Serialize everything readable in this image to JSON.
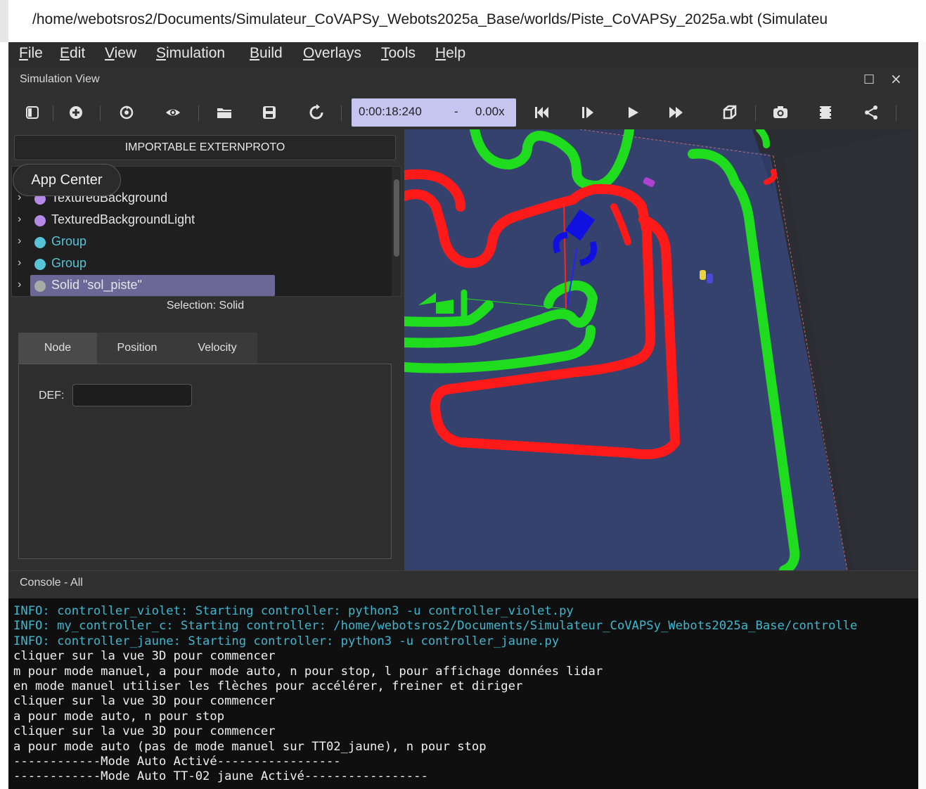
{
  "window": {
    "title": "/home/webotsros2/Documents/Simulateur_CoVAPSy_Webots2025a_Base/worlds/Piste_CoVAPSy_2025a.wbt (Simulateu"
  },
  "menu": [
    "File",
    "Edit",
    "View",
    "Simulation",
    "Build",
    "Overlays",
    "Tools",
    "Help"
  ],
  "simulation_view": {
    "title": "Simulation View",
    "maximize_icon": "□",
    "close_icon": "×"
  },
  "toolbar": {
    "time": "0:00:18:240",
    "dash": "-",
    "speed": "0.00x",
    "icons": [
      "toggle-scene-tree-icon",
      "add-node-icon",
      "reset-view-icon",
      "view-eye-icon",
      "open-world-icon",
      "save-world-icon",
      "reload-world-icon",
      "reset-simulation-icon",
      "step-icon",
      "play-icon",
      "fast-forward-icon",
      "view-cube-icon",
      "screenshot-icon",
      "record-movie-icon",
      "share-icon"
    ]
  },
  "scene_tree": {
    "importable_button": "IMPORTABLE EXTERNPROTO",
    "app_center": "App Center",
    "items": [
      {
        "label": "TexturedBackground",
        "color": "#b48ae6"
      },
      {
        "label": "TexturedBackgroundLight",
        "color": "#b48ae6"
      },
      {
        "label": "Group",
        "color": "#56c4d6"
      },
      {
        "label": "Group",
        "color": "#56c4d6"
      },
      {
        "label": "Solid \"sol_piste\"",
        "color": "#a9aba5"
      }
    ]
  },
  "selection": {
    "label": "Selection: Solid",
    "tabs": [
      "Node",
      "Position",
      "Velocity"
    ],
    "def_label": "DEF:",
    "def_value": ""
  },
  "console": {
    "title": "Console - All",
    "lines": [
      {
        "text": "INFO: controller_violet: Starting controller: python3 -u controller_violet.py",
        "kind": "info"
      },
      {
        "text": "INFO: my_controller_c: Starting controller: /home/webotsros2/Documents/Simulateur_CoVAPSy_Webots2025a_Base/controlle",
        "kind": "info"
      },
      {
        "text": "INFO: controller_jaune: Starting controller: python3 -u controller_jaune.py",
        "kind": "info"
      },
      {
        "text": "cliquer sur la vue 3D pour commencer",
        "kind": "out"
      },
      {
        "text": "m pour mode manuel, a pour mode auto, n pour stop, l pour affichage données lidar",
        "kind": "out"
      },
      {
        "text": "en mode manuel utiliser les flèches pour accélérer, freiner et diriger",
        "kind": "out"
      },
      {
        "text": "cliquer sur la vue 3D pour commencer",
        "kind": "out"
      },
      {
        "text": "a pour mode auto, n pour stop",
        "kind": "out"
      },
      {
        "text": "cliquer sur la vue 3D pour commencer",
        "kind": "out"
      },
      {
        "text": "a pour mode auto (pas de mode manuel sur TT02_jaune), n pour stop",
        "kind": "out"
      },
      {
        "text": "------------Mode Auto Activé-----------------",
        "kind": "out"
      },
      {
        "text": "------------Mode Auto TT-02 jaune Activé-----------------",
        "kind": "out"
      }
    ]
  },
  "colors": {
    "track_red": "#ff1a1a",
    "track_green": "#1fdc1f",
    "floor": "#36426e",
    "info_text": "#3fb7cf",
    "timebox": "#c5c5ef",
    "selected_row": "#6b6797"
  }
}
